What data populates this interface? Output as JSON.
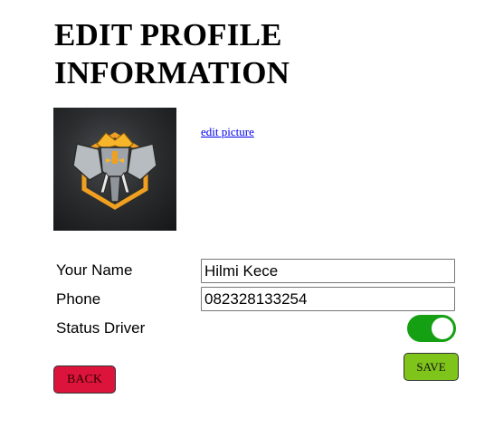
{
  "page": {
    "title": "EDIT PROFILE INFORMATION"
  },
  "profile": {
    "edit_picture_link": "edit picture",
    "avatar_icon": "elephant-emblem-logo"
  },
  "form": {
    "name_label": "Your Name",
    "name_value": "Hilmi Kece",
    "phone_label": "Phone",
    "phone_value": "082328133254",
    "status_label": "Status Driver",
    "status_driver_on": true
  },
  "actions": {
    "back_label": "BACK",
    "save_label": "SAVE"
  },
  "colors": {
    "toggle_on": "#14a012",
    "back_button": "#dc143c",
    "save_button": "#7fc41a",
    "link": "#0000ee"
  }
}
